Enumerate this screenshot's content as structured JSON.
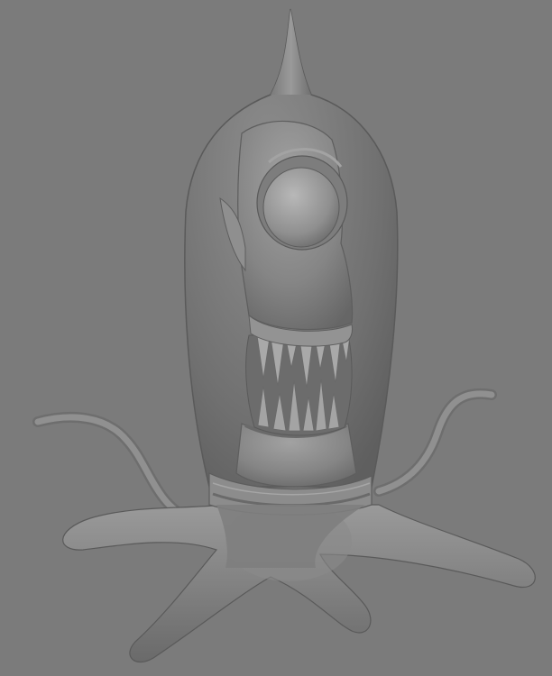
{
  "viewport": {
    "background_color": "#7b7b7b"
  },
  "model": {
    "subject": "alien-creature-3d-model",
    "shading": "grey-clay",
    "base_color": "#8a8a8a",
    "highlight_color": "#a8a8a8",
    "shadow_color": "#5e5e5e"
  }
}
